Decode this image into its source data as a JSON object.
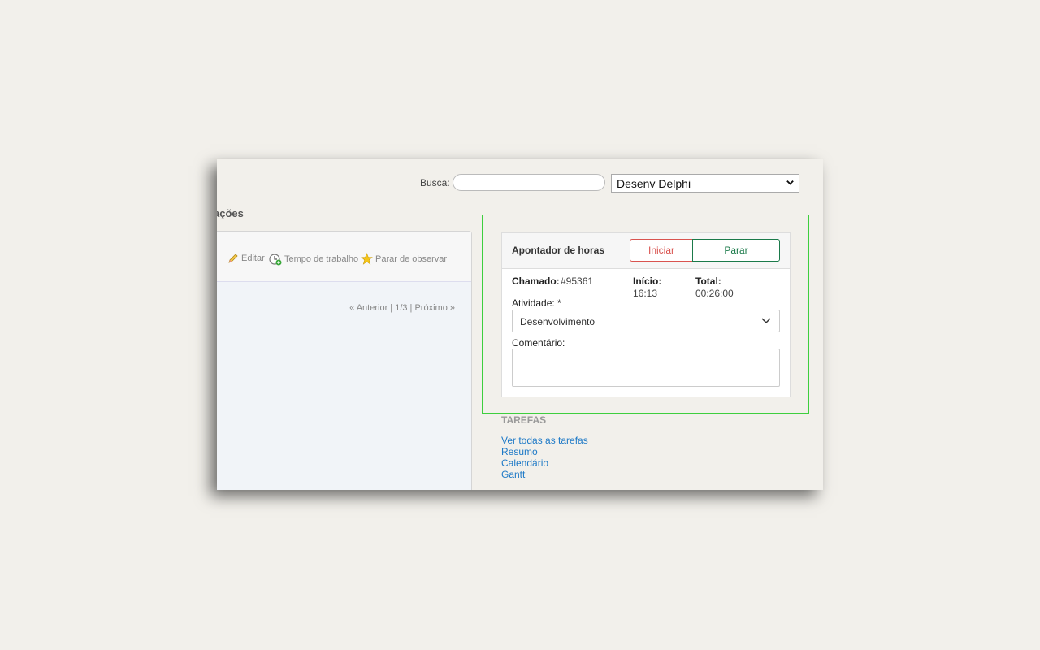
{
  "header": {
    "search_label": "Busca:",
    "search_value": "",
    "project_select": "Desenv Delphi"
  },
  "main": {
    "section_title": "ações",
    "toolbar": {
      "edit_label": "Editar",
      "time_label": "Tempo de trabalho",
      "unwatch_label": "Parar de observar"
    },
    "pager": "« Anterior | 1/3 | Próximo »"
  },
  "timer": {
    "title": "Apontador de horas",
    "start_label": "Iniciar",
    "stop_label": "Parar",
    "ticket_label": "Chamado:",
    "ticket_value": "#95361",
    "start_time_label": "Início:",
    "start_time_value": "16:13",
    "total_label": "Total:",
    "total_value": "00:26:00",
    "activity_label": "Atividade: *",
    "activity_value": "Desenvolvimento",
    "comment_label": "Comentário:",
    "comment_value": ""
  },
  "tasks": {
    "title": "TAREFAS",
    "links": [
      "Ver todas as tarefas",
      "Resumo",
      "Calendário",
      "Gantt"
    ]
  },
  "colors": {
    "start_button": "#d9534f",
    "stop_button": "#1b7a4a",
    "highlight_border": "#3ecf3e",
    "link": "#1f7ac7"
  }
}
